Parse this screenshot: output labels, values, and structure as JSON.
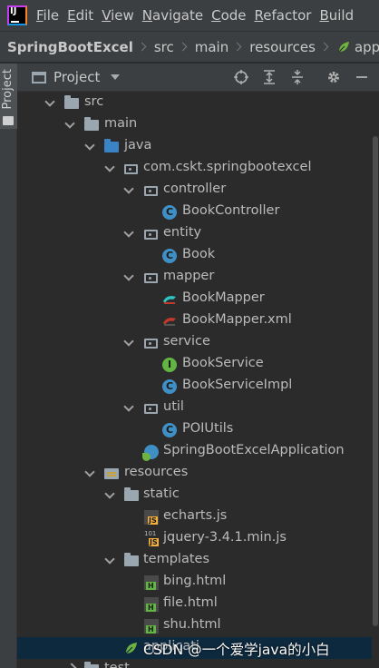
{
  "menubar": {
    "items": [
      {
        "label": "File",
        "mnemonic_index": 0
      },
      {
        "label": "Edit",
        "mnemonic_index": 0
      },
      {
        "label": "View",
        "mnemonic_index": 0
      },
      {
        "label": "Navigate",
        "mnemonic_index": 0
      },
      {
        "label": "Code",
        "mnemonic_index": 0
      },
      {
        "label": "Refactor",
        "mnemonic_index": 0
      },
      {
        "label": "Build",
        "mnemonic_index": 0
      }
    ]
  },
  "breadcrumb": {
    "items": [
      "SpringBootExcel",
      "src",
      "main",
      "resources",
      "application.y"
    ]
  },
  "toolstrip": {
    "tab_label": "Project"
  },
  "project_panel": {
    "title": "Project"
  },
  "tree": [
    {
      "label": "src",
      "icon": "folder-icon",
      "expanded": true
    },
    {
      "label": "main",
      "icon": "folder-icon",
      "expanded": true
    },
    {
      "label": "java",
      "icon": "source-folder-icon",
      "expanded": true
    },
    {
      "label": "com.cskt.springbootexcel",
      "icon": "package-icon",
      "expanded": true
    },
    {
      "label": "controller",
      "icon": "package-icon",
      "expanded": true
    },
    {
      "label": "BookController",
      "icon": "java-class-icon"
    },
    {
      "label": "entity",
      "icon": "package-icon",
      "expanded": true
    },
    {
      "label": "Book",
      "icon": "java-class-icon"
    },
    {
      "label": "mapper",
      "icon": "package-icon",
      "expanded": true
    },
    {
      "label": "BookMapper",
      "icon": "mybatis-mapper-icon"
    },
    {
      "label": "BookMapper.xml",
      "icon": "mybatis-xml-icon"
    },
    {
      "label": "service",
      "icon": "package-icon",
      "expanded": true
    },
    {
      "label": "BookService",
      "icon": "java-interface-icon"
    },
    {
      "label": "BookServiceImpl",
      "icon": "java-class-icon"
    },
    {
      "label": "util",
      "icon": "package-icon",
      "expanded": true
    },
    {
      "label": "POIUtils",
      "icon": "java-class-icon"
    },
    {
      "label": "SpringBootExcelApplication",
      "icon": "spring-boot-app-icon"
    },
    {
      "label": "resources",
      "icon": "resources-folder-icon",
      "expanded": true
    },
    {
      "label": "static",
      "icon": "folder-icon",
      "expanded": true
    },
    {
      "label": "echarts.js",
      "icon": "js-file-icon"
    },
    {
      "label": "jquery-3.4.1.min.js",
      "icon": "minified-js-file-icon"
    },
    {
      "label": "templates",
      "icon": "folder-icon",
      "expanded": true
    },
    {
      "label": "bing.html",
      "icon": "html-file-icon"
    },
    {
      "label": "file.html",
      "icon": "html-file-icon"
    },
    {
      "label": "shu.html",
      "icon": "html-file-icon"
    },
    {
      "label": "applicati",
      "icon": "spring-config-icon",
      "selected": true
    },
    {
      "label": "test",
      "icon": "folder-icon",
      "expanded": false
    }
  ],
  "watermark": "CSDN @一个爱学java的小白",
  "colors": {
    "background": "#2b2b2b",
    "chrome": "#3c3f41",
    "selection": "#0d293e",
    "text": "#bbbbbb",
    "java_class": "#3f8fc5",
    "interface": "#62b543",
    "spring": "#6db33f"
  }
}
